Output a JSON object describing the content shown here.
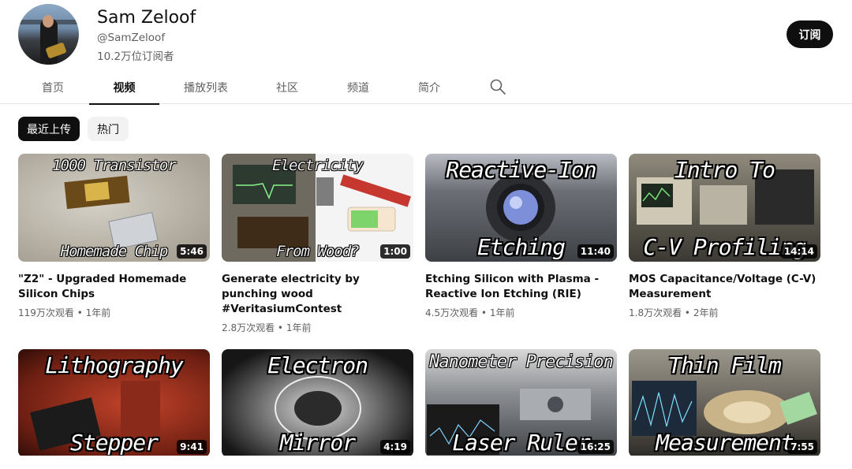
{
  "channel": {
    "name": "Sam Zeloof",
    "handle": "@SamZeloof",
    "subscribers": "10.2万位订阅者",
    "subscribe_label": "订阅"
  },
  "tabs": [
    {
      "label": "首页"
    },
    {
      "label": "视频"
    },
    {
      "label": "播放列表"
    },
    {
      "label": "社区"
    },
    {
      "label": "频道"
    },
    {
      "label": "简介"
    }
  ],
  "active_tab": "视频",
  "search_icon": "search-icon",
  "chips": [
    {
      "label": "最近上传"
    },
    {
      "label": "热门"
    }
  ],
  "videos": [
    {
      "title": "\"Z2\" - Upgraded Homemade Silicon Chips",
      "views": "119万次观看",
      "age": "1年前",
      "duration": "5:46",
      "thumb_top": "1000 Transistor",
      "thumb_bottom": "Homemade Chip",
      "bg": "#b9b4ab"
    },
    {
      "title": "Generate electricity by punching wood #VeritasiumContest",
      "views": "2.8万次观看",
      "age": "1年前",
      "duration": "1:00",
      "thumb_top": "Electricity",
      "thumb_bottom": "From Wood?",
      "bg": "#8b7a5f"
    },
    {
      "title": "Etching Silicon with Plasma - Reactive Ion Etching (RIE)",
      "views": "4.5万次观看",
      "age": "1年前",
      "duration": "11:40",
      "thumb_top": "Reactive-Ion",
      "thumb_bottom": "Etching",
      "bg": "#5c6066"
    },
    {
      "title": "MOS Capacitance/Voltage (C-V) Measurement",
      "views": "1.8万次观看",
      "age": "2年前",
      "duration": "14:14",
      "thumb_top": "Intro To",
      "thumb_bottom": "C-V Profiling",
      "bg": "#6d6a5e"
    },
    {
      "title": "",
      "views": "",
      "age": "",
      "duration": "9:41",
      "thumb_top": "Lithography",
      "thumb_bottom": "Stepper",
      "bg": "#6e1f12"
    },
    {
      "title": "",
      "views": "",
      "age": "",
      "duration": "4:19",
      "thumb_top": "Electron",
      "thumb_bottom": "Mirror",
      "bg": "#2a2a2a"
    },
    {
      "title": "",
      "views": "",
      "age": "",
      "duration": "16:25",
      "thumb_top": "Nanometer Precision",
      "thumb_bottom": "Laser Ruler",
      "bg": "#50545a"
    },
    {
      "title": "",
      "views": "",
      "age": "",
      "duration": "7:55",
      "thumb_top": "Thin Film",
      "thumb_bottom": "Measurement",
      "bg": "#5e5a52"
    }
  ],
  "meta_separator": "•"
}
